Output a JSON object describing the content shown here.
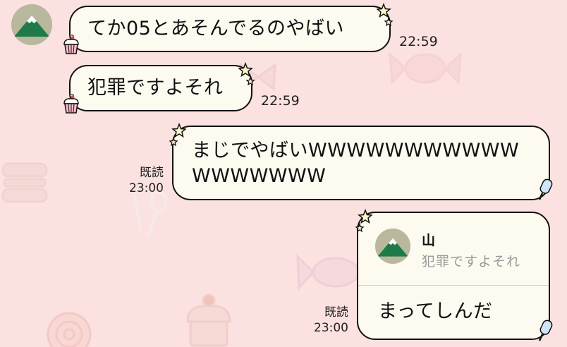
{
  "messages": [
    {
      "text": "てか05とあそんでるのやばい",
      "time": "22:59"
    },
    {
      "text": "犯罪ですよそれ",
      "time": "22:59"
    },
    {
      "line1": "まじでやばいWWWWWWWWWWW",
      "line2": "WWWWWWW",
      "read": "既読",
      "time": "23:00"
    },
    {
      "reply_name": "山",
      "reply_quote": "犯罪ですよそれ",
      "text": "まってしんだ",
      "read": "既読",
      "time": "23:00"
    }
  ],
  "colors": {
    "background": "#fbe1df",
    "bubble": "#fdfaf0",
    "avatar_bg": "#b9b79c",
    "mountain": "#1f7a4a"
  },
  "icons": [
    "mountain-avatar-icon",
    "star-icon",
    "cupcake-icon",
    "popsicle-icon"
  ]
}
